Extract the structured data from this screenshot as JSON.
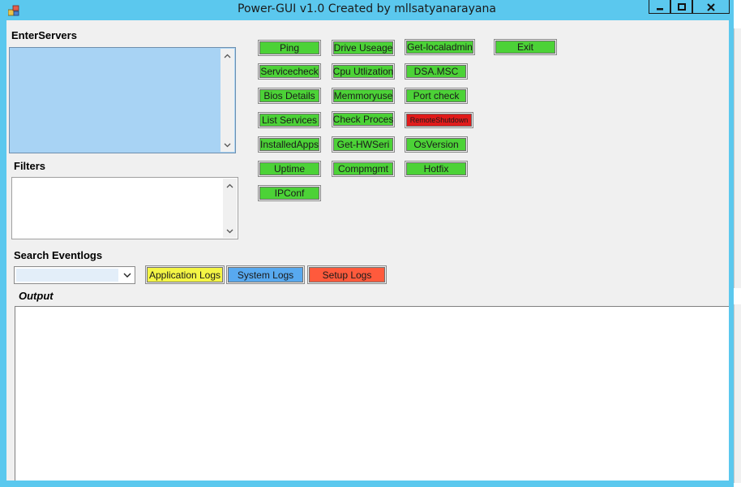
{
  "window": {
    "title": "Power-GUI v1.0 Created by mllsatyanarayana",
    "accent_color": "#5bc8ee",
    "controls": [
      "minimize-icon",
      "maximize-icon",
      "close-icon"
    ]
  },
  "labels": {
    "enter_servers": "EnterServers",
    "filters": "Filters",
    "search_eventlogs": "Search Eventlogs",
    "output": "Output"
  },
  "buttons": {
    "ping": "Ping",
    "drive_useage": "Drive Useage",
    "get_localadmin": "Get-localadmin",
    "exit": "Exit",
    "servicecheck": "Servicecheck",
    "cpu_utlization": "Cpu Utlization",
    "dsa_msc": "DSA.MSC",
    "bios_details": "Bios Details",
    "memmoryuse": "Memmoryuse",
    "port_check": "Port check",
    "list_services": "List Services",
    "check_proces": "Check Proces",
    "remote_shutdown": "RemoteShutdown",
    "installed_apps": "InstalledApps",
    "get_hwseri": "Get-HWSeri",
    "os_version": "OsVersion",
    "uptime": "Uptime",
    "compmgmt": "Compmgmt",
    "hotfix": "Hotfix",
    "ipconf": "IPConf"
  },
  "log_buttons": {
    "application": "Application Logs",
    "system": "System Logs",
    "setup": "Setup Logs"
  },
  "colors": {
    "button_green": "#4cd237",
    "remote_shutdown_red": "#e01b1b",
    "application_yellow": "#f4f545",
    "system_blue": "#58a9ef",
    "setup_orange": "#ff5a3c",
    "server_list_bg": "#a8d3f4"
  },
  "eventlog_select": {
    "value": ""
  },
  "server_list": {
    "value": ""
  },
  "filters_box": {
    "value": ""
  },
  "output_box": {
    "value": ""
  }
}
